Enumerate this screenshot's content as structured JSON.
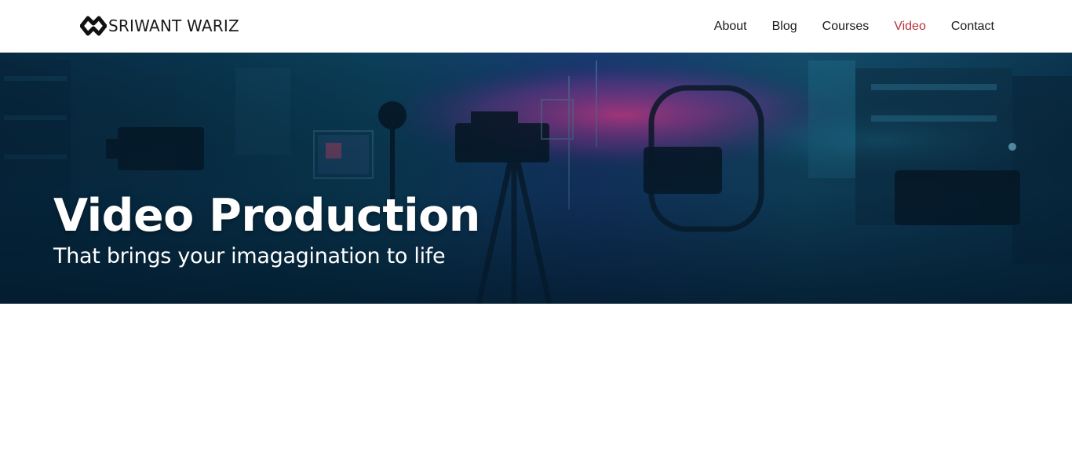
{
  "brand": {
    "name": "SRIWANT WARIZ",
    "logo_icon": "sw-logo-icon"
  },
  "nav": {
    "items": [
      {
        "label": "About"
      },
      {
        "label": "Blog"
      },
      {
        "label": "Courses"
      },
      {
        "label": "Video"
      },
      {
        "label": "Contact"
      }
    ],
    "active": "Video"
  },
  "hero": {
    "title": "Video Production",
    "subtitle": "That brings your imagagination to life",
    "background": "video-studio-equipment-image"
  },
  "colors": {
    "active_nav": "#b8323d",
    "text_dark": "#1a1a1a",
    "hero_overlay": "#0a2a44",
    "hero_accent": "#e0409a"
  }
}
